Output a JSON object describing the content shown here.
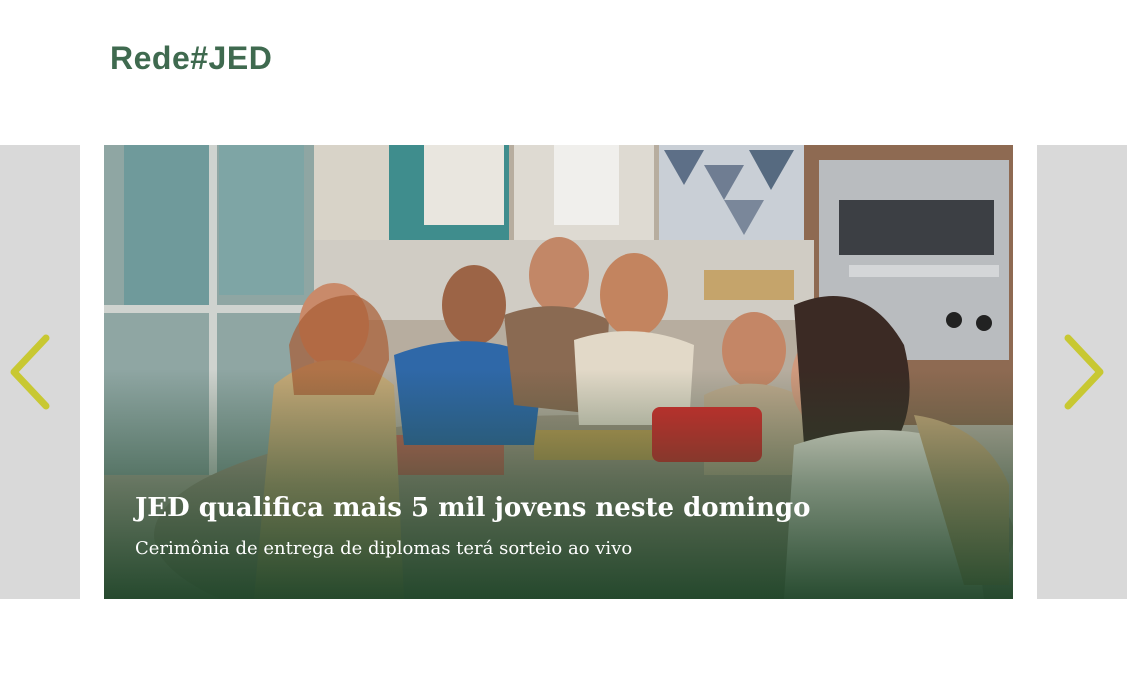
{
  "header": {
    "logo_text": "Rede#JED"
  },
  "carousel": {
    "prev_icon": "chevron-left-icon",
    "next_icon": "chevron-right-icon",
    "arrow_color": "#c8c832",
    "slide": {
      "title": "JED qualifica mais 5 mil jovens neste domingo",
      "subtitle": "Cerimônia de entrega de diplomas terá sorteio ao vivo",
      "image_alt": "Grupo de jovens sorrindo e tirando selfie em uma cozinha"
    }
  },
  "colors": {
    "brand_green": "#3f6a4f",
    "caption_gradient": "#1e4428",
    "side_panel": "#d9d9d9"
  }
}
